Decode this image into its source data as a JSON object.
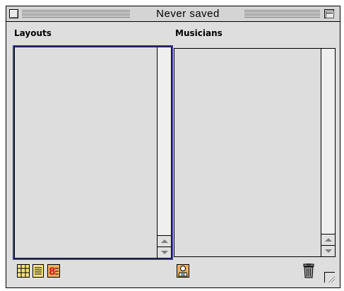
{
  "window": {
    "title": "Never saved"
  },
  "panes": {
    "layouts": {
      "label": "Layouts",
      "items": []
    },
    "musicians": {
      "label": "Musicians",
      "items": []
    }
  },
  "toolbar": {
    "icons": [
      "layout-grid-icon",
      "page-icon",
      "numbered-list-icon",
      "musician-person-icon",
      "trash-icon"
    ]
  },
  "colors": {
    "window_bg": "#dedede",
    "list_bg": "#dddddd",
    "focus_ring": "#3a3a9a",
    "icon_yellow": "#f6e27a",
    "icon_orange": "#f0b060",
    "icon_red": "#d02020"
  }
}
